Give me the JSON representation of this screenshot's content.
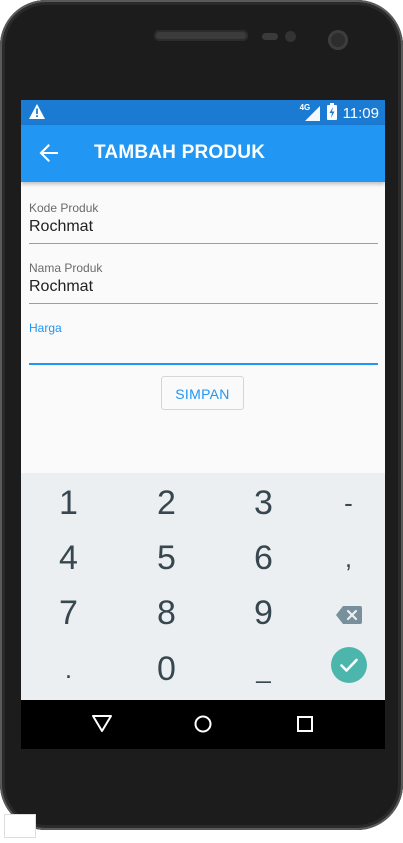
{
  "status_bar": {
    "network": "4G",
    "time": "11:09",
    "icons": [
      "warning-icon",
      "signal-icon",
      "battery-charging-icon"
    ]
  },
  "app_bar": {
    "title": "TAMBAH PRODUK",
    "back_icon": "arrow-left-icon"
  },
  "form": {
    "fields": [
      {
        "label": "Kode Produk",
        "value": "Rochmat"
      },
      {
        "label": "Nama Produk",
        "value": "Rochmat"
      },
      {
        "label": "Harga",
        "value": ""
      }
    ],
    "submit_label": "SIMPAN"
  },
  "keyboard": {
    "rows": [
      [
        "1",
        "2",
        "3",
        "-"
      ],
      [
        "4",
        "5",
        "6",
        ","
      ],
      [
        "7",
        "8",
        "9",
        "backspace"
      ],
      [
        ".",
        "0",
        "_",
        "done"
      ]
    ],
    "accent": "#4db6ac"
  },
  "nav_bar": {
    "icons": [
      "back-triangle-icon",
      "home-circle-icon",
      "recents-square-icon"
    ]
  },
  "colors": {
    "primary": "#2196f3",
    "status_bar": "#1b7bd3",
    "keyboard_bg": "#eceff1",
    "key_text": "#37474f"
  }
}
